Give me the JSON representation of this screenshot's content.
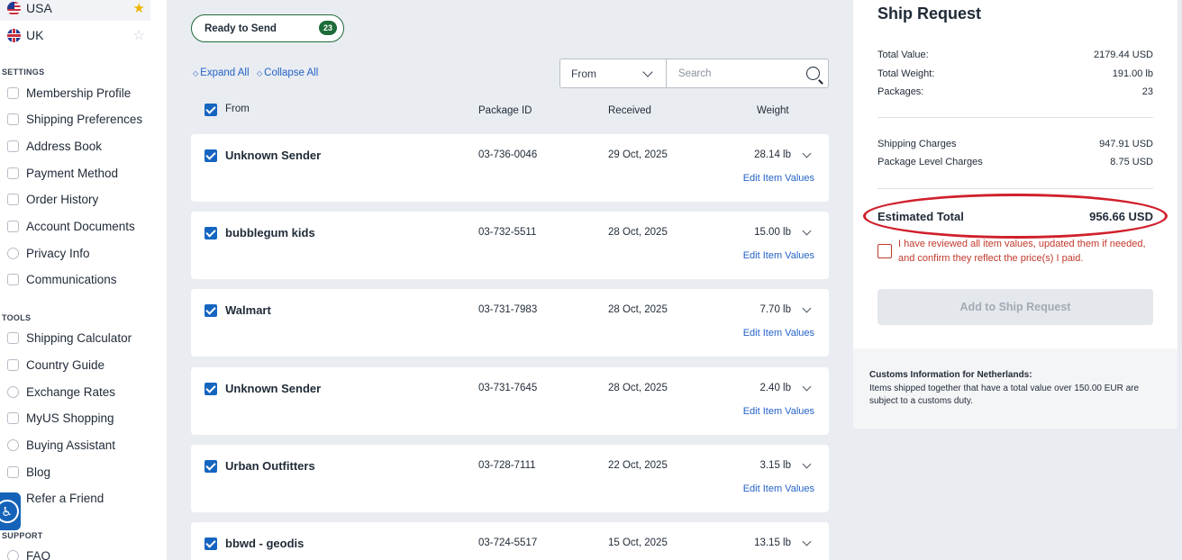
{
  "sidebar": {
    "countries": [
      {
        "label": "USA",
        "favorite": true
      },
      {
        "label": "UK",
        "favorite": false
      }
    ],
    "settings_title": "SETTINGS",
    "settings_items": [
      {
        "label": "Membership Profile",
        "icon": "id-card-icon"
      },
      {
        "label": "Shipping Preferences",
        "icon": "box-icon"
      },
      {
        "label": "Address Book",
        "icon": "book-icon"
      },
      {
        "label": "Payment Method",
        "icon": "card-icon"
      },
      {
        "label": "Order History",
        "icon": "history-icon"
      },
      {
        "label": "Account Documents",
        "icon": "document-icon"
      },
      {
        "label": "Privacy Info",
        "icon": "privacy-icon"
      },
      {
        "label": "Communications",
        "icon": "chat-icon"
      }
    ],
    "tools_title": "TOOLS",
    "tools_items": [
      {
        "label": "Shipping Calculator",
        "icon": "calculator-icon"
      },
      {
        "label": "Country Guide",
        "icon": "calendar-icon"
      },
      {
        "label": "Exchange Rates",
        "icon": "dollar-icon"
      },
      {
        "label": "MyUS Shopping",
        "icon": "cart-icon"
      },
      {
        "label": "Buying Assistant",
        "icon": "assistant-icon"
      },
      {
        "label": "Blog",
        "icon": "blog-icon"
      },
      {
        "label": "Refer a Friend",
        "icon": "gift-icon"
      }
    ],
    "support_title": "SUPPORT",
    "support_items": [
      {
        "label": "FAQ",
        "icon": "question-icon"
      }
    ]
  },
  "main": {
    "ready_label": "Ready to Send",
    "ready_count": "23",
    "expand_all": "Expand All",
    "collapse_all": "Collapse All",
    "from_select": "From",
    "search_placeholder": "Search",
    "columns": {
      "from": "From",
      "package_id": "Package ID",
      "received": "Received",
      "weight": "Weight"
    },
    "edit_label": "Edit Item Values",
    "packages": [
      {
        "sender": "Unknown Sender",
        "id": "03-736-0046",
        "received": "29 Oct, 2025",
        "weight": "28.14 lb"
      },
      {
        "sender": "bubblegum kids",
        "id": "03-732-5511",
        "received": "28 Oct, 2025",
        "weight": "15.00 lb"
      },
      {
        "sender": "Walmart",
        "id": "03-731-7983",
        "received": "28 Oct, 2025",
        "weight": "7.70 lb"
      },
      {
        "sender": "Unknown Sender",
        "id": "03-731-7645",
        "received": "28 Oct, 2025",
        "weight": "2.40 lb"
      },
      {
        "sender": "Urban Outfitters",
        "id": "03-728-7111",
        "received": "22 Oct, 2025",
        "weight": "3.15 lb"
      },
      {
        "sender": "bbwd - geodis",
        "id": "03-724-5517",
        "received": "15 Oct, 2025",
        "weight": "13.15 lb"
      }
    ]
  },
  "ship_request": {
    "title": "Ship Request",
    "total_value_label": "Total Value:",
    "total_value": "2179.44 USD",
    "total_weight_label": "Total Weight:",
    "total_weight": "191.00 lb",
    "packages_label": "Packages:",
    "packages": "23",
    "shipping_charges_label": "Shipping Charges",
    "shipping_charges": "947.91 USD",
    "package_level_label": "Package Level Charges",
    "package_level": "8.75 USD",
    "estimated_total_label": "Estimated Total",
    "estimated_total": "956.66 USD",
    "confirm_text": "I have reviewed all item values, updated them if needed, and confirm they reflect the price(s) I paid.",
    "add_button": "Add to Ship Request"
  },
  "customs": {
    "title": "Customs Information for Netherlands:",
    "text": "Items shipped together that have a total value over 150.00 EUR are subject to a customs duty."
  }
}
